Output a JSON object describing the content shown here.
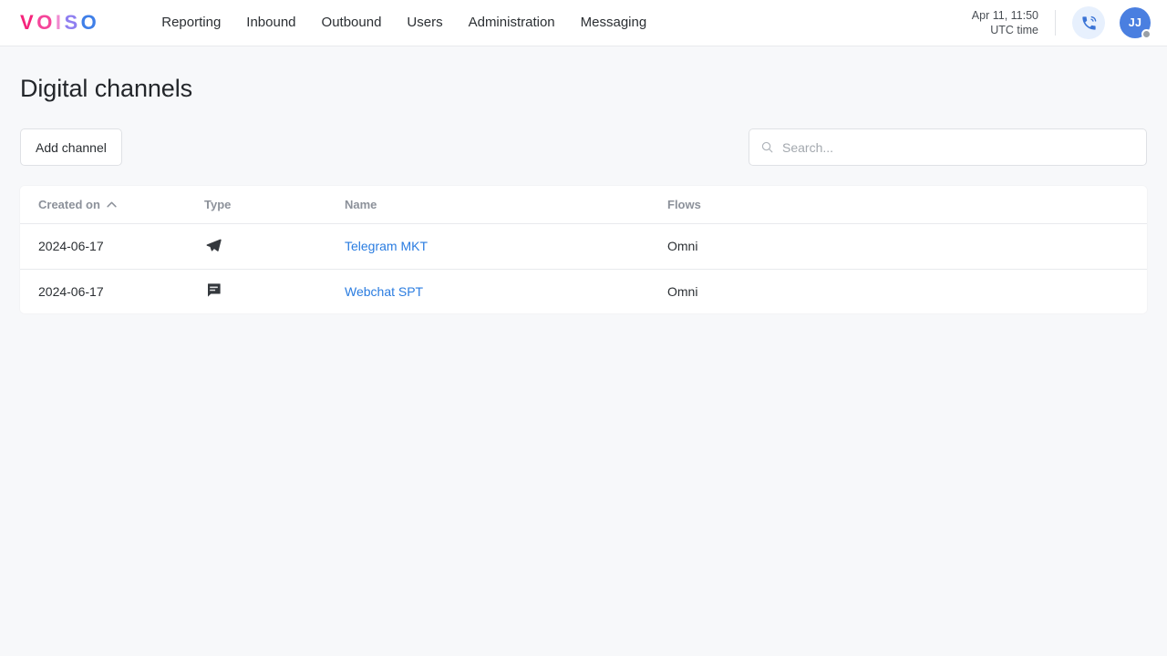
{
  "header": {
    "logo": {
      "letters": [
        "V",
        "O",
        "I",
        "S",
        "O"
      ],
      "colors": [
        "#f5247b",
        "#f5459a",
        "#f08cd0",
        "#8f7ff0",
        "#3f7fe8"
      ]
    },
    "nav": [
      {
        "label": "Reporting"
      },
      {
        "label": "Inbound"
      },
      {
        "label": "Outbound"
      },
      {
        "label": "Users"
      },
      {
        "label": "Administration"
      },
      {
        "label": "Messaging"
      }
    ],
    "clock": {
      "datetime": "Apr 11, 11:50",
      "timezone": "UTC time"
    },
    "phone_icon": "phone-in-talk-icon",
    "avatar": {
      "initials": "JJ",
      "color": "#4a7fe0",
      "status_color": "#9aa0a6"
    }
  },
  "page": {
    "title": "Digital channels"
  },
  "toolbar": {
    "add_label": "Add channel",
    "search_placeholder": "Search...",
    "search_value": ""
  },
  "table": {
    "columns": [
      {
        "label": "Created on",
        "sorted": "asc"
      },
      {
        "label": "Type",
        "sorted": "none"
      },
      {
        "label": "Name",
        "sorted": "none"
      },
      {
        "label": "Flows",
        "sorted": "none"
      }
    ],
    "rows": [
      {
        "created_on": "2024-06-17",
        "type_icon": "telegram-send-icon",
        "name": "Telegram MKT",
        "flows": "Omni"
      },
      {
        "created_on": "2024-06-17",
        "type_icon": "webchat-bubble-icon",
        "name": "Webchat SPT",
        "flows": "Omni"
      }
    ]
  },
  "colors": {
    "link": "#2a7ce0",
    "accent": "#4a7fe0",
    "background": "#f7f8fa"
  }
}
